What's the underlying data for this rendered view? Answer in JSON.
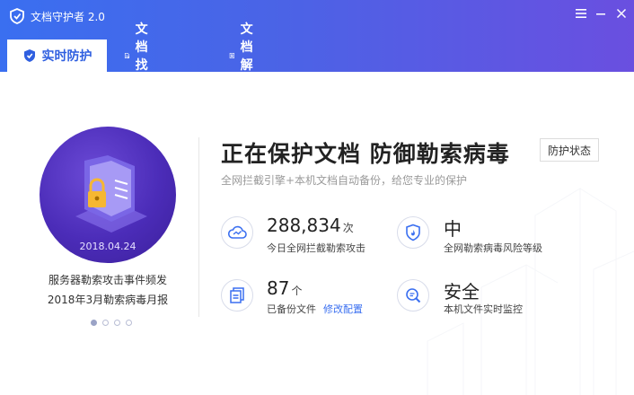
{
  "window": {
    "title": "文档守护者 2.0"
  },
  "tabs": [
    {
      "label": "实时防护",
      "icon": "shield-icon",
      "active": true
    },
    {
      "label": "文档找回",
      "icon": "document-recover-icon",
      "active": false
    },
    {
      "label": "文档解密",
      "icon": "document-decrypt-icon",
      "active": false
    }
  ],
  "banner": {
    "date": "2018.04.24",
    "line1": "服务器勒索攻击事件频发",
    "line2": "2018年3月勒索病毒月报"
  },
  "main": {
    "title": "正在保护文档 防御勒索病毒",
    "status_button": "防护状态",
    "subtitle": "全网拦截引擎+本机文档自动备份，给您专业的保护"
  },
  "stats": {
    "blocked": {
      "value": "288,834",
      "unit": "次",
      "desc": "今日全网拦截勒索攻击"
    },
    "risk": {
      "value": "中",
      "desc": "全网勒索病毒风险等级"
    },
    "backup": {
      "value": "87",
      "unit": "个",
      "desc": "已备份文件",
      "link": "修改配置"
    },
    "monitor": {
      "value": "安全",
      "desc": "本机文件实时监控"
    }
  },
  "colors": {
    "accent": "#3a6ff0",
    "header_end": "#6a4fe0",
    "banner": "#4b2cb8"
  }
}
